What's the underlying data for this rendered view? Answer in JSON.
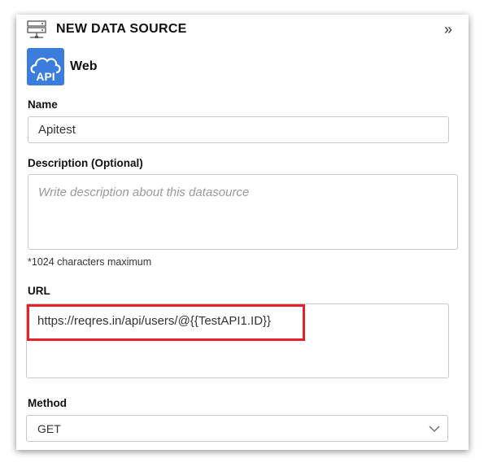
{
  "header": {
    "title": "NEW DATA SOURCE",
    "collapse_icon": "double-chevron-right-icon",
    "icon": "server-icon"
  },
  "source": {
    "type": "Web",
    "icon_text": "API"
  },
  "name": {
    "label": "Name",
    "value": "Apitest"
  },
  "description": {
    "label": "Description (Optional)",
    "placeholder": "Write description about this datasource",
    "hint": "*1024 characters maximum"
  },
  "url": {
    "label": "URL",
    "value": "https://reqres.in/api/users/@{{TestAPI1.ID}}"
  },
  "method": {
    "label": "Method",
    "value": "GET"
  },
  "colors": {
    "accent": "#3b7ddd",
    "highlight": "#e8202a"
  }
}
